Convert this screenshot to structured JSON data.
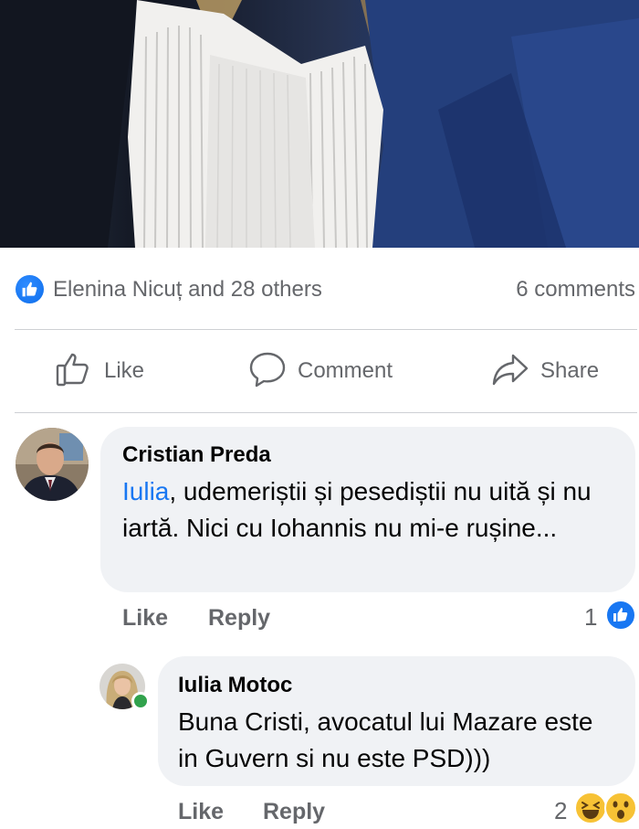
{
  "post": {
    "reactions_summary": "Elenina Nicuț and 28 others",
    "comments_count": "6 comments"
  },
  "actions": {
    "like_label": "Like",
    "comment_label": "Comment",
    "share_label": "Share"
  },
  "comments": [
    {
      "author": "Cristian Preda",
      "mention": "Iulia",
      "text": ", udemeriștii și pesediștii nu uită și nu iartă. Nici cu Iohannis nu mi-e rușine...",
      "like_label": "Like",
      "reply_label": "Reply",
      "reaction_count": "1",
      "reaction_icons": [
        "like-icon"
      ]
    },
    {
      "author": "Iulia Motoc",
      "text": "Buna Cristi, avocatul lui Mazare este in Guvern si nu este PSD)))",
      "like_label": "Like",
      "reply_label": "Reply",
      "reaction_count": "2",
      "reaction_icons": [
        "haha-emoji-icon",
        "wow-emoji-icon"
      ],
      "online": true
    }
  ],
  "colors": {
    "accent": "#1877f2",
    "secondary_text": "#65676b",
    "bubble": "#f0f2f5",
    "divider": "#ced0d4",
    "online": "#31a24c"
  }
}
